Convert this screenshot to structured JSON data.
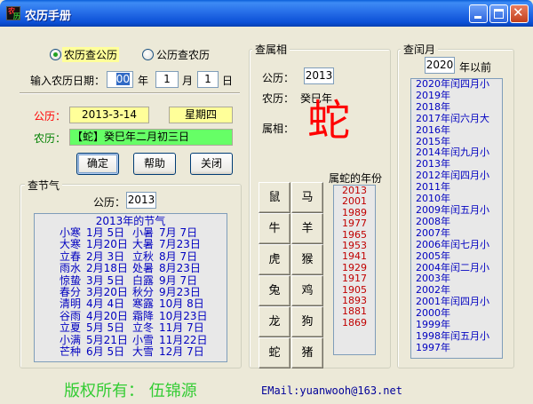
{
  "window": {
    "title": "农历手册"
  },
  "converter": {
    "mode_solar_to_lunar": "农历查公历",
    "mode_lunar_to_solar": "公历查农历",
    "input_label": "输入农历日期：",
    "year_value": "00",
    "year_unit": "年",
    "month_value": "1",
    "month_unit": "月",
    "day_value": "1",
    "day_unit": "日",
    "solar_label": "公历：",
    "solar_value": "2013-3-14",
    "weekday_value": "星期四",
    "lunar_label": "农历：",
    "lunar_value": "【蛇】癸巳年二月初三日",
    "ok_label": "确定",
    "help_label": "帮助",
    "close_label": "关闭"
  },
  "solar_terms": {
    "group_title": "查节气",
    "year_label": "公历：",
    "year_value": "2013",
    "list_title": "2013年的节气",
    "rows": [
      [
        "小寒",
        "1月 5日",
        "小暑",
        "7月 7日"
      ],
      [
        "大寒",
        "1月20日",
        "大暑",
        "7月23日"
      ],
      [
        "立春",
        "2月 3日",
        "立秋",
        "8月 7日"
      ],
      [
        "雨水",
        "2月18日",
        "处暑",
        "8月23日"
      ],
      [
        "惊蛰",
        "3月 5日",
        "白露",
        "9月 7日"
      ],
      [
        "春分",
        "3月20日",
        "秋分",
        "9月23日"
      ],
      [
        "清明",
        "4月 4日",
        "寒露",
        "10月 8日"
      ],
      [
        "谷雨",
        "4月20日",
        "霜降",
        "10月23日"
      ],
      [
        "立夏",
        "5月 5日",
        "立冬",
        "11月 7日"
      ],
      [
        "小满",
        "5月21日",
        "小雪",
        "11月22日"
      ],
      [
        "芒种",
        "6月 5日",
        "大雪",
        "12月 7日"
      ]
    ]
  },
  "zodiac": {
    "group_title": "查属相",
    "solar_label": "公历：",
    "year_value": "2013",
    "lunar_label": "农历：",
    "lunar_value": "癸巳年",
    "animal_label": "属相：",
    "animal": "蛇",
    "animals": [
      "鼠",
      "马",
      "牛",
      "羊",
      "虎",
      "猴",
      "兔",
      "鸡",
      "龙",
      "狗",
      "蛇",
      "猪"
    ],
    "years_title": "属蛇的年份",
    "years": [
      "2013",
      "2001",
      "1989",
      "1977",
      "1965",
      "1953",
      "1941",
      "1929",
      "1917",
      "1905",
      "1893",
      "1881",
      "1869"
    ]
  },
  "leap_month": {
    "group_title": "查闰月",
    "year_value": "2020",
    "year_suffix": "年以前",
    "items": [
      "2020年闰四月小",
      "2019年",
      "2018年",
      "2017年闰六月大",
      "2016年",
      "2015年",
      "2014年闰九月小",
      "2013年",
      "2012年闰四月小",
      "2011年",
      "2010年",
      "2009年闰五月小",
      "2008年",
      "2007年",
      "2006年闰七月小",
      "2005年",
      "2004年闰二月小",
      "2003年",
      "2002年",
      "2001年闰四月小",
      "2000年",
      "1999年",
      "1998年闰五月小",
      "1997年"
    ]
  },
  "footer": {
    "copyright": "版权所有：  伍锦源",
    "email": "EMail:yuanwooh@163.net"
  },
  "colors": {
    "label_red": "#FF0000",
    "label_green": "#008000",
    "list_blue": "#0000C0",
    "year_red": "#C00000",
    "yellow_field": "#FFFF99",
    "green_field": "#66FF66",
    "copyright_green": "#33CC33",
    "email_blue": "#000099",
    "animal_red": "#FF0000"
  }
}
